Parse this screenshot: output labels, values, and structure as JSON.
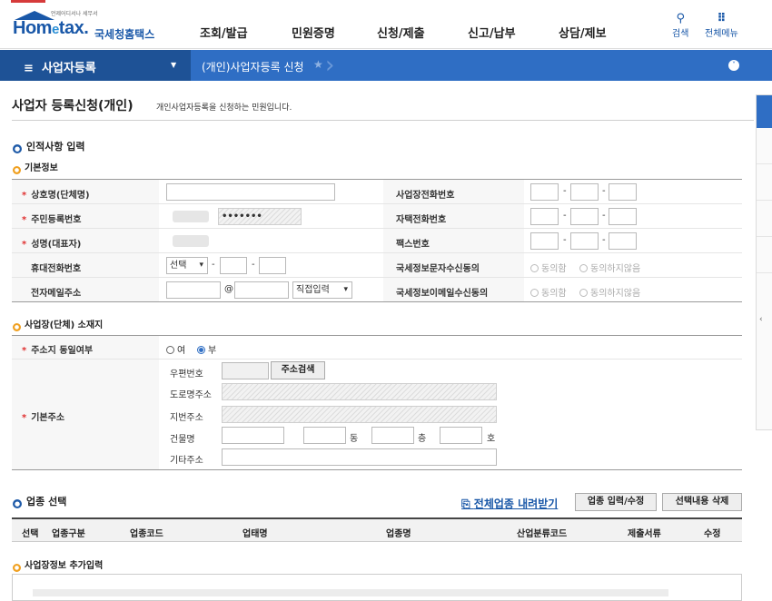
{
  "header": {
    "logo_tiny": "언제어디서나 세무서",
    "logo_home": "Hom",
    "logo_e": "e",
    "logo_tax": "tax.",
    "logo_sub": "국세청홈택스",
    "menu": [
      "조회/발급",
      "민원증명",
      "신청/제출",
      "신고/납부",
      "상담/제보"
    ],
    "search_label": "검색",
    "allmenu_label": "전체메뉴"
  },
  "navbar": {
    "menu_label": "사업자등록",
    "breadcrumb": "(개인)사업자등록 신청"
  },
  "page": {
    "title": "사업자 등록신청(개인)",
    "desc": "개인사업자등록을 신청하는 민원입니다."
  },
  "sections": {
    "personal": "인적사항 입력",
    "basic": "기본정보",
    "location": "사업장(단체) 소재지",
    "industry": "업종 선택",
    "extra": "사업장정보 추가입력"
  },
  "form": {
    "trade_name": "상호명(단체명)",
    "resident_no": "주민등록번호",
    "resident_masked": "•••••••",
    "rep_name": "성명(대표자)",
    "mobile": "휴대전화번호",
    "mobile_select": "선택",
    "email": "전자메일주소",
    "email_at": "@",
    "email_select": "직접입력",
    "biz_phone": "사업장전화번호",
    "home_phone": "자택전화번호",
    "fax": "팩스번호",
    "sms_consent": "국세정보문자수신동의",
    "email_consent": "국세정보이메일수신동의",
    "agree": "동의함",
    "disagree": "동의하지않음",
    "same_addr": "주소지 동일여부",
    "yes": "여",
    "no": "부",
    "basic_addr": "기본주소",
    "postal": "우편번호",
    "addr_search": "주소검색",
    "road_addr": "도로명주소",
    "lot_addr": "지번주소",
    "building": "건물명",
    "dong": "동",
    "floor": "층",
    "ho": "호",
    "other_addr": "기타주소"
  },
  "industry": {
    "download_link": "전체업종 내려받기",
    "input_button": "업종 입력/수정",
    "delete_button": "선택내용 삭제",
    "columns": [
      "선택",
      "업종구분",
      "업종코드",
      "업태명",
      "업종명",
      "산업분류코드",
      "제출서류",
      "수정"
    ]
  },
  "colors": {
    "brand": "#1a58a8",
    "navbar": "#2f6ec4",
    "navbar_dark": "#1e5296",
    "required": "#e03030",
    "sub_dot": "#f0a020"
  }
}
